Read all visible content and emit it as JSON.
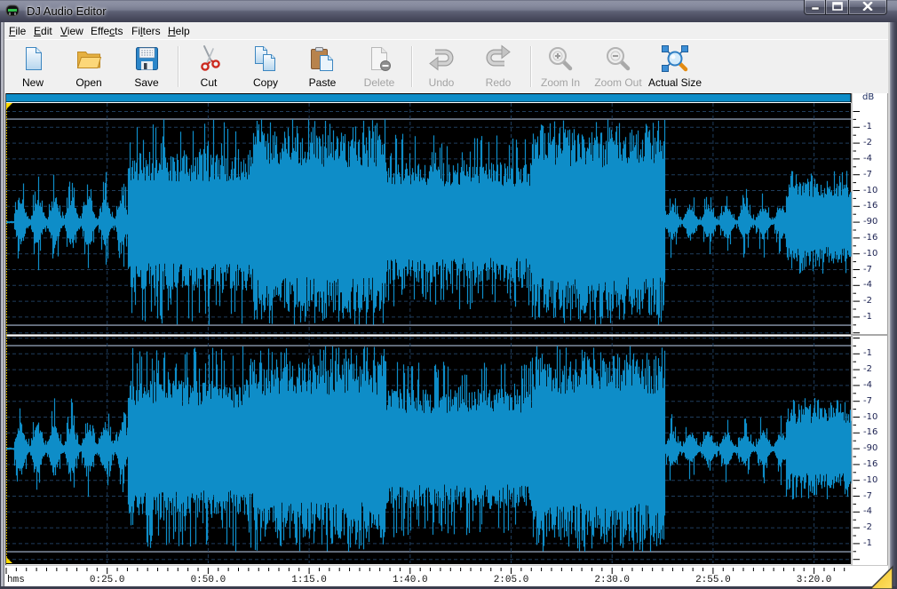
{
  "window": {
    "title": "DJ Audio Editor",
    "app_icon": "dj-headphones-icon",
    "controls": [
      {
        "id": "minimize",
        "icon": "minimize-icon"
      },
      {
        "id": "maximize",
        "icon": "maximize-icon"
      },
      {
        "id": "close",
        "icon": "close-icon"
      }
    ]
  },
  "menu": {
    "items": [
      {
        "label": "File",
        "before": "",
        "key": "F",
        "after": "ile"
      },
      {
        "label": "Edit",
        "before": "",
        "key": "E",
        "after": "dit"
      },
      {
        "label": "View",
        "before": "",
        "key": "V",
        "after": "iew"
      },
      {
        "label": "Effects",
        "before": "Effe",
        "key": "c",
        "after": "ts"
      },
      {
        "label": "Filters",
        "before": "Fi",
        "key": "l",
        "after": "ters"
      },
      {
        "label": "Help",
        "before": "",
        "key": "H",
        "after": "elp"
      }
    ]
  },
  "toolbar": {
    "items": [
      {
        "label": "New",
        "icon": "new-file-icon",
        "enabled": true
      },
      {
        "label": "Open",
        "icon": "open-folder-icon",
        "enabled": true
      },
      {
        "label": "Save",
        "icon": "save-floppy-icon",
        "enabled": true
      },
      {
        "label": "Cut",
        "icon": "scissors-icon",
        "enabled": true
      },
      {
        "label": "Copy",
        "icon": "copy-icon",
        "enabled": true
      },
      {
        "label": "Paste",
        "icon": "paste-clipboard-icon",
        "enabled": true
      },
      {
        "label": "Delete",
        "icon": "delete-icon",
        "enabled": false
      },
      {
        "label": "Undo",
        "icon": "undo-arrow-icon",
        "enabled": false
      },
      {
        "label": "Redo",
        "icon": "redo-arrow-icon",
        "enabled": false
      },
      {
        "label": "Zoom In",
        "icon": "zoom-in-icon",
        "enabled": false
      },
      {
        "label": "Zoom Out",
        "icon": "zoom-out-icon",
        "enabled": false
      },
      {
        "label": "Actual Size",
        "icon": "actual-size-icon",
        "enabled": true
      }
    ]
  },
  "editor": {
    "channels": [
      "left",
      "right"
    ],
    "db_scale": {
      "unit": "dB",
      "ticks": [
        "-1",
        "-2",
        "-4",
        "-7",
        "-10",
        "-16",
        "-90",
        "-16",
        "-10",
        "-7",
        "-4",
        "-2",
        "-1"
      ]
    },
    "time_scale": {
      "unit": "hms",
      "major_interval_s": 25,
      "minor_interval_s": 2.5,
      "ticks": [
        {
          "t": 25,
          "label": "0:25.0"
        },
        {
          "t": 50,
          "label": "0:50.0"
        },
        {
          "t": 75,
          "label": "1:15.0"
        },
        {
          "t": 100,
          "label": "1:40.0"
        },
        {
          "t": 125,
          "label": "2:05.0"
        },
        {
          "t": 150,
          "label": "2:30.0"
        },
        {
          "t": 175,
          "label": "2:55.0"
        },
        {
          "t": 200,
          "label": "3:20.0"
        }
      ]
    },
    "waveform": {
      "duration_s": 209.5,
      "amplitude_units": "fraction of full scale",
      "segments": [
        {
          "start": 0,
          "end": 1.8,
          "style": "silent",
          "body": 0.01,
          "peak": 0.01
        },
        {
          "start": 1.8,
          "end": 30,
          "style": "bursty",
          "period": 4.2,
          "body": 0.22,
          "peak": 0.5
        },
        {
          "start": 30,
          "end": 61,
          "style": "dense",
          "body": 0.55,
          "peak": 1.0
        },
        {
          "start": 61,
          "end": 94,
          "style": "dense",
          "body": 0.72,
          "peak": 1.0
        },
        {
          "start": 94,
          "end": 130,
          "style": "dense",
          "body": 0.48,
          "peak": 0.86
        },
        {
          "start": 130,
          "end": 163,
          "style": "dense",
          "body": 0.74,
          "peak": 1.0
        },
        {
          "start": 163,
          "end": 193,
          "style": "bursty",
          "period": 4.5,
          "body": 0.15,
          "peak": 0.37
        },
        {
          "start": 193,
          "end": 209.5,
          "style": "dense",
          "body": 0.33,
          "peak": 0.5
        }
      ]
    },
    "colors": {
      "waveform": "#0e8dc8",
      "background": "#000000",
      "grid": "#1f3d5c",
      "clip_line": "#8d9bb0",
      "marker": "#ffd800",
      "overview_bar": "#0e8dc8"
    }
  }
}
